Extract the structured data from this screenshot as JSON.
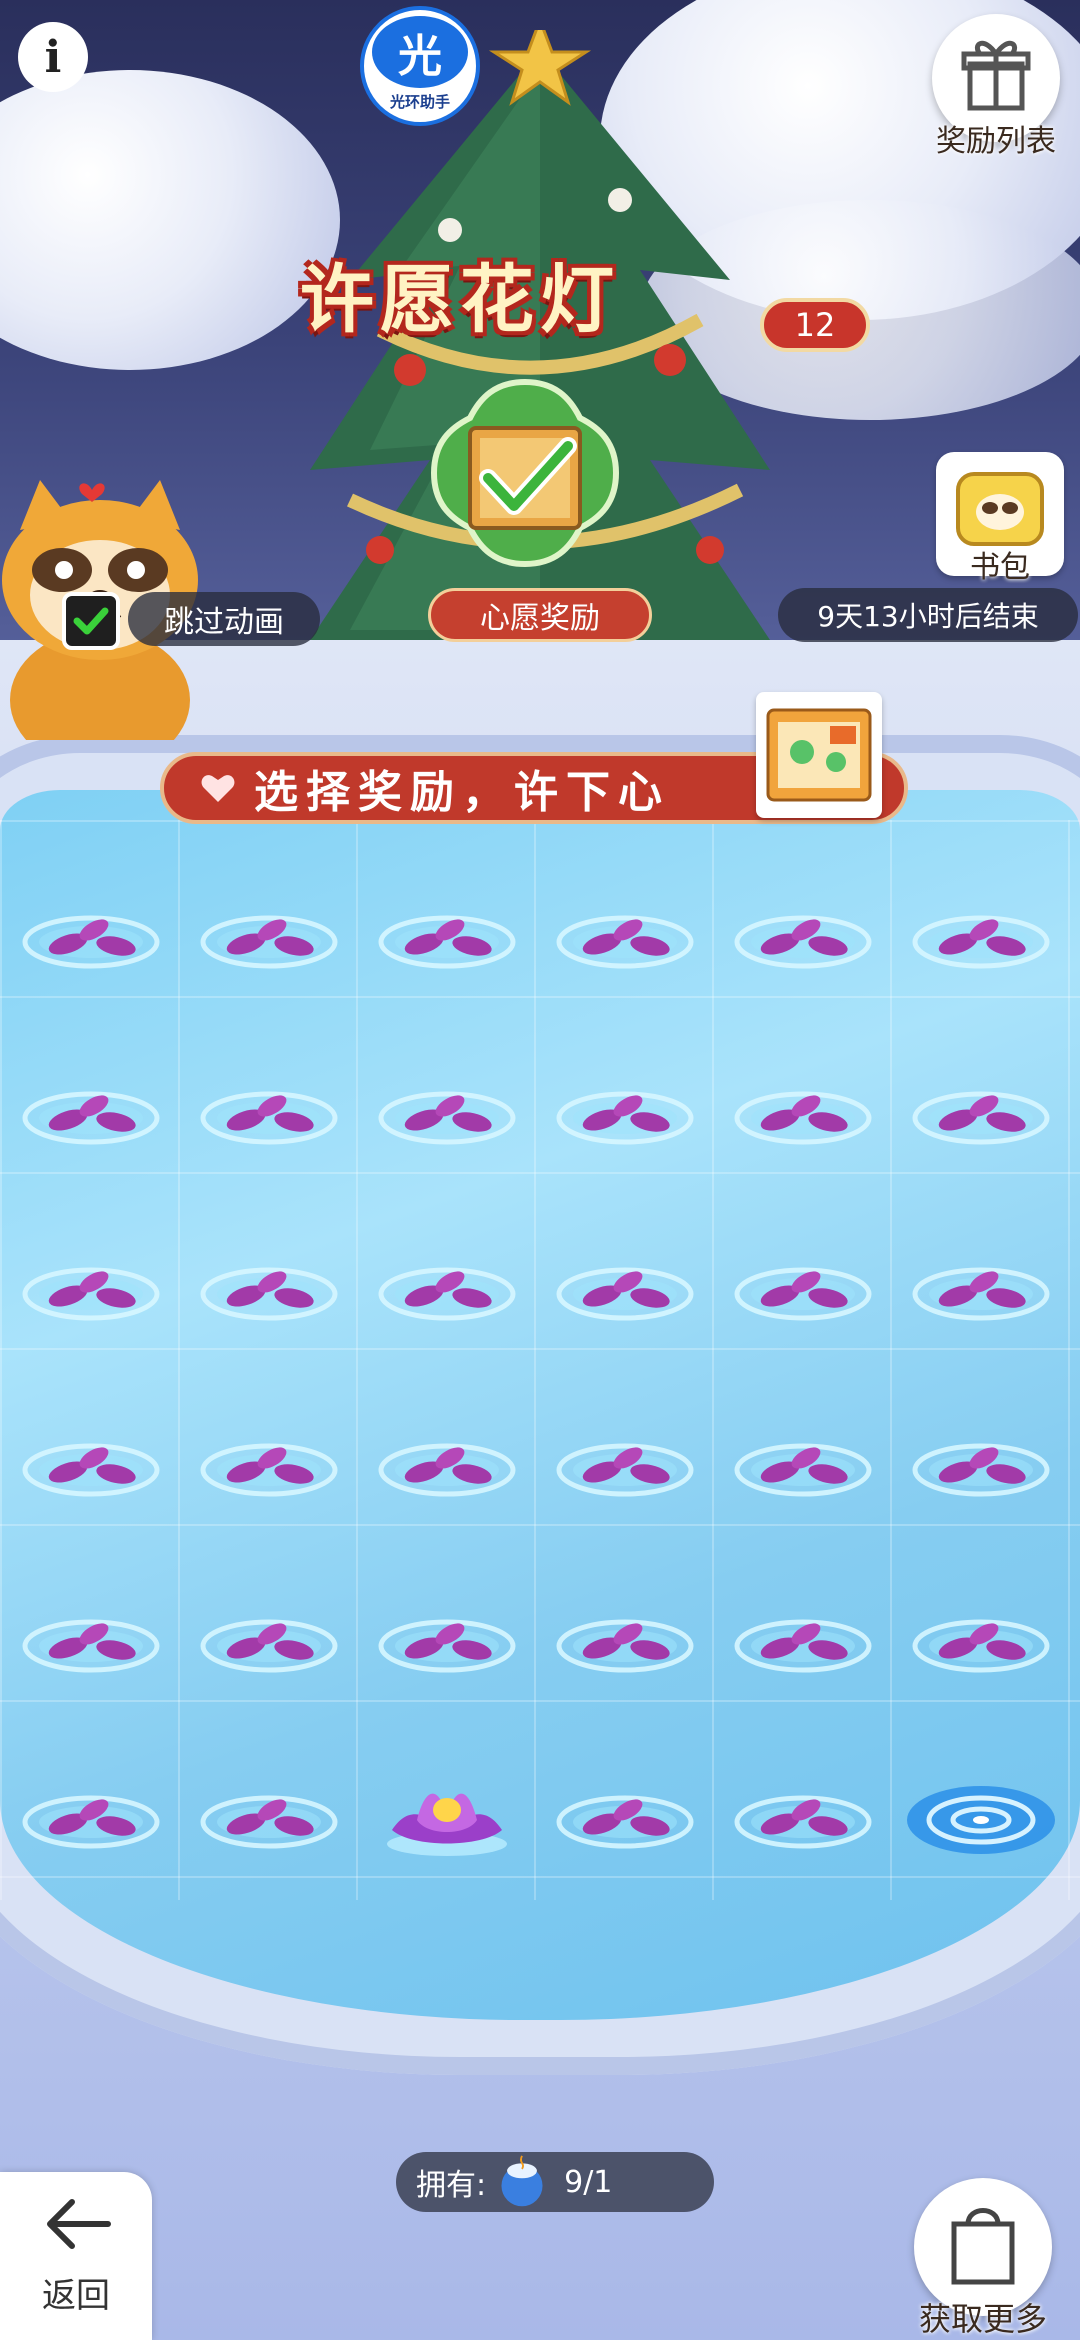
{
  "top_bar": {
    "info_icon": "info-icon",
    "logo_char": "光",
    "logo_text": "光环助手",
    "rewards_list_label": "奖励列表",
    "rewards_list_icon": "gift-icon"
  },
  "event": {
    "title": "许愿花灯",
    "count": "12",
    "wish_reward_label": "心愿奖励",
    "bag_label": "书包",
    "skip_animation_label": "跳过动画",
    "skip_animation_checked": true,
    "countdown": "9天13小时后结束"
  },
  "banner": {
    "text": "选择奖励，许下心"
  },
  "pond": {
    "rows": 6,
    "cols": 6,
    "lotus_position": {
      "row": 6,
      "col": 3
    },
    "whirlpool_position": {
      "row": 6,
      "col": 6
    }
  },
  "footer": {
    "own_label": "拥有:",
    "own_value": "9/1",
    "back_label": "返回",
    "more_label": "获取更多",
    "back_icon": "arrow-left-icon",
    "more_icon": "shopping-bag-icon"
  },
  "colors": {
    "accent_red": "#c0392b",
    "pond_blue": "#86cdf1",
    "petal_purple": "#a23aa8"
  }
}
